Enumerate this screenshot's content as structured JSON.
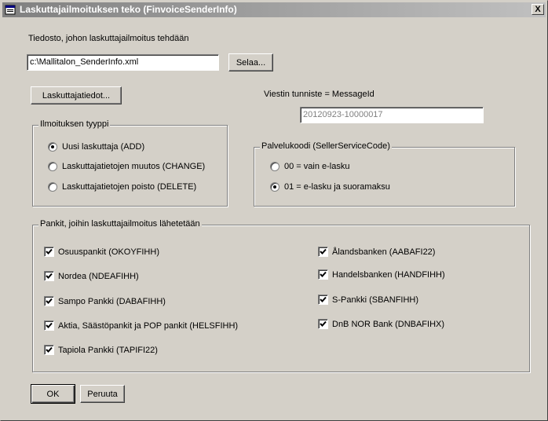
{
  "window": {
    "title": "Laskuttajailmoituksen teko (FinvoiceSenderInfo)",
    "close_label": "X"
  },
  "file": {
    "label": "Tiedosto, johon laskuttajailmoitus tehdään",
    "path": "c:\\Mallitalon_SenderInfo.xml",
    "browse_label": "Selaa..."
  },
  "sender_details_button": "Laskuttajatiedot...",
  "message": {
    "label": "Viestin tunniste = MessageId",
    "id": "20120923-10000017"
  },
  "notice_type": {
    "legend": "Ilmoituksen tyyppi",
    "options": [
      {
        "label": "Uusi laskuttaja (ADD)",
        "selected": true
      },
      {
        "label": "Laskuttajatietojen muutos (CHANGE)",
        "selected": false
      },
      {
        "label": "Laskuttajatietojen poisto (DELETE)",
        "selected": false
      }
    ]
  },
  "service_code": {
    "legend": "Palvelukoodi (SellerServiceCode)",
    "options": [
      {
        "label": "00 = vain e-lasku",
        "selected": false
      },
      {
        "label": "01 = e-lasku ja suoramaksu",
        "selected": true
      }
    ]
  },
  "banks": {
    "legend": "Pankit, joihin laskuttajailmoitus lähetetään",
    "left": [
      {
        "label": "Osuuspankit (OKOYFIHH)",
        "checked": true
      },
      {
        "label": "Nordea (NDEAFIHH)",
        "checked": true
      },
      {
        "label": "Sampo Pankki (DABAFIHH)",
        "checked": true
      },
      {
        "label": "Aktia, Säästöpankit ja POP pankit (HELSFIHH)",
        "checked": true
      },
      {
        "label": "Tapiola Pankki (TAPIFI22)",
        "checked": true
      }
    ],
    "right": [
      {
        "label": "Ålandsbanken (AABAFI22)",
        "checked": true
      },
      {
        "label": "Handelsbanken (HANDFIHH)",
        "checked": true
      },
      {
        "label": "S-Pankki (SBANFIHH)",
        "checked": true
      },
      {
        "label": "DnB NOR Bank (DNBAFIHX)",
        "checked": true
      }
    ]
  },
  "buttons": {
    "ok_label": "OK",
    "cancel_label": "Peruuta"
  }
}
